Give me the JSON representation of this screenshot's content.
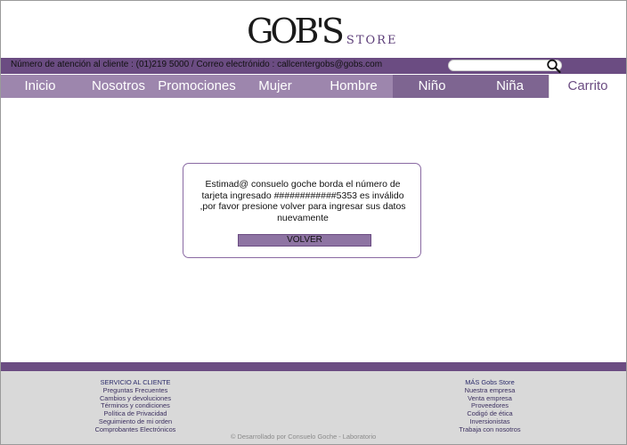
{
  "header": {
    "logo_main": "GOB'S",
    "logo_sub": "STORE"
  },
  "info_bar": {
    "text": "Número de atención al cliente : (01)219 5000 / Correo electrónido : callcentergobs@gobs.com",
    "search_placeholder": ""
  },
  "nav": {
    "items": [
      {
        "label": "Inicio"
      },
      {
        "label": "Nosotros"
      },
      {
        "label": "Promociones"
      },
      {
        "label": "Mujer"
      },
      {
        "label": "Hombre"
      },
      {
        "label": "Niño"
      },
      {
        "label": "Niña"
      },
      {
        "label": "Carrito"
      }
    ]
  },
  "dialog": {
    "message": "Estimad@ consuelo goche borda el número de tarjeta ingresado ############5353 es inválido ,por favor presione volver para ingresar sus datos nuevamente",
    "button_label": "VOLVER"
  },
  "footer": {
    "left_heading": "SERVICIO AL CLIENTE",
    "left_links": [
      "Preguntas Frecuentes",
      "Cambios y devoluciones",
      "Términos y condiciones",
      "Política de Privacidad",
      "Seguimiento de mi orden",
      "Comprobantes Electrónicos"
    ],
    "right_heading": "MÁS Gobs Store",
    "right_links": [
      "Nuestra empresa",
      "Venta empresa",
      "Proveedores",
      "Codigó de ética",
      "Inversionistas",
      "Trabaja con nosotros"
    ],
    "credit": "© Desarrollado por Consuelo Goche - Laboratorio"
  },
  "colors": {
    "brand_purple": "#6b4c82",
    "nav_purple": "#9d86ad",
    "footer_gray": "#d9d9d9"
  }
}
